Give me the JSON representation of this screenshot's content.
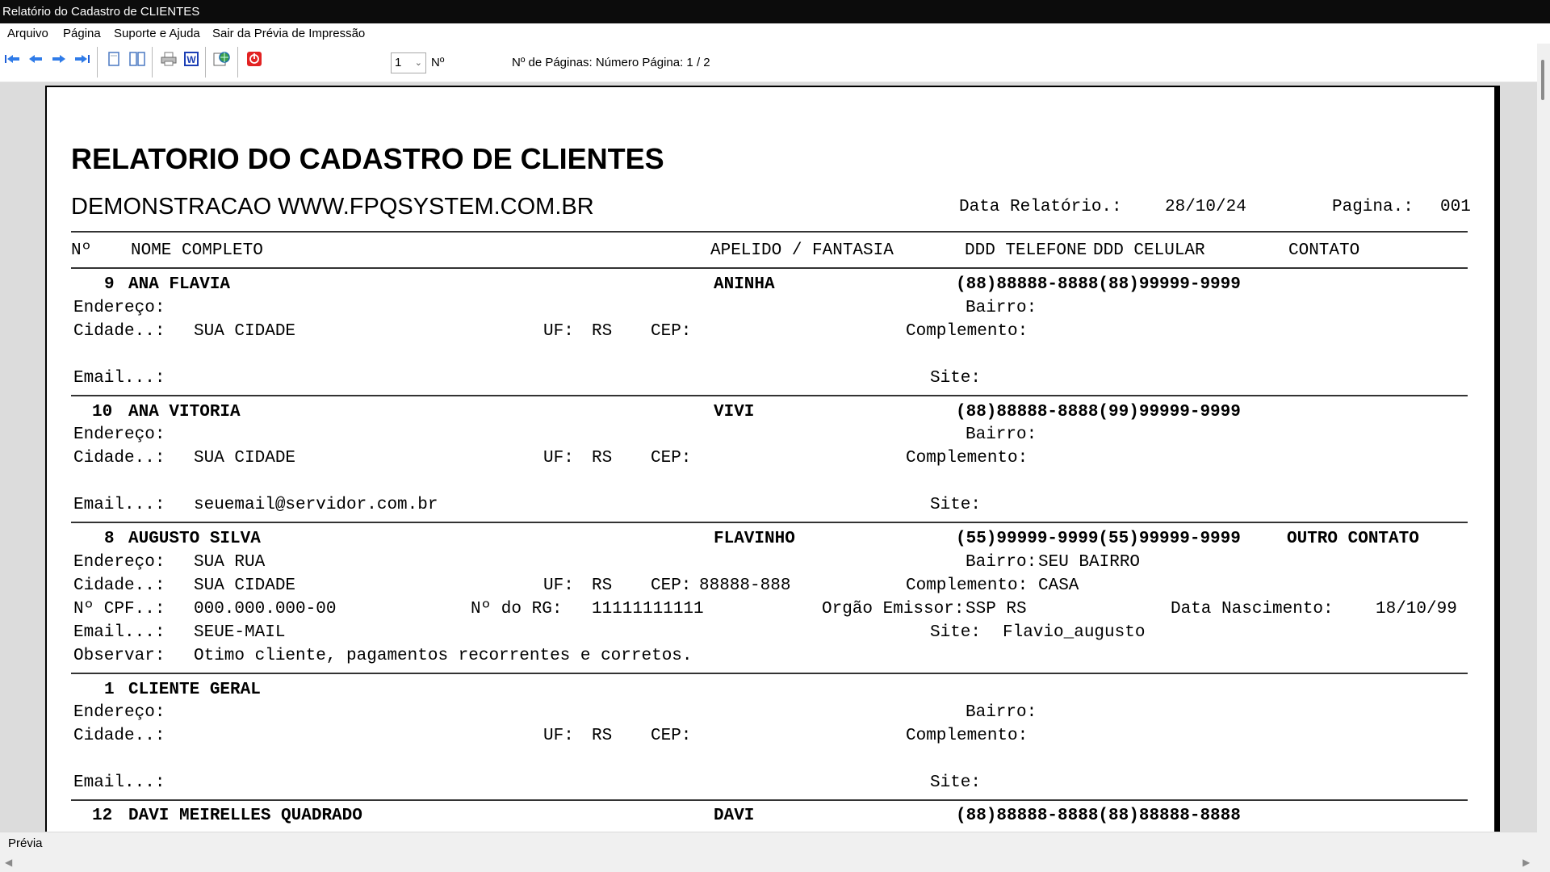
{
  "window": {
    "title": "Relatório do Cadastro de CLIENTES"
  },
  "menu": [
    "Arquivo",
    "Página",
    "Suporte e Ajuda",
    "Sair da Prévia de Impressão"
  ],
  "toolbar": {
    "icons": [
      "first-page-icon",
      "prev-page-icon",
      "next-page-icon",
      "last-page-icon",
      "single-page-icon",
      "two-page-icon",
      "print-icon",
      "word-export-icon",
      "web-export-icon",
      "stop-icon"
    ],
    "page_select_value": "1",
    "no_label": "Nº",
    "pages_info": "Nº de Páginas: Número Página: 1 / 2"
  },
  "report": {
    "title": "RELATORIO DO CADASTRO DE CLIENTES",
    "subtitle": "DEMONSTRACAO WWW.FPQSYSTEM.COM.BR",
    "date_label": "Data Relatório.:",
    "date_value": "28/10/24",
    "page_label": "Pagina.:",
    "page_value": "001",
    "columns": [
      "Nº",
      "NOME COMPLETO",
      "APELIDO / FANTASIA",
      "DDD TELEFONE",
      "DDD CELULAR",
      "CONTATO"
    ],
    "labels": {
      "endereco": "Endereço:",
      "bairro": "Bairro:",
      "cidade": "Cidade..:",
      "uf": "UF:",
      "cep": "CEP:",
      "complemento": "Complemento:",
      "email": "Email...:",
      "site": "Site:",
      "cpf": "Nº CPF..:",
      "rg": "Nº do RG:",
      "orgao": "Orgão Emissor:",
      "nascimento": "Data Nascimento:",
      "observar": "Observar:"
    },
    "records": [
      {
        "num": "9",
        "name": "ANA FLAVIA",
        "nickname": "ANINHA",
        "phones": "(88)88888-8888(88)99999-9999",
        "contact": "",
        "endereco": "",
        "bairro": "",
        "cidade": "SUA CIDADE",
        "uf": "RS",
        "cep": "",
        "complemento": "",
        "email": "",
        "site": ""
      },
      {
        "num": "10",
        "name": "ANA VITORIA",
        "nickname": "VIVI",
        "phones": "(88)88888-8888(99)99999-9999",
        "contact": "",
        "endereco": "",
        "bairro": "",
        "cidade": "SUA CIDADE",
        "uf": "RS",
        "cep": "",
        "complemento": "",
        "email": "seuemail@servidor.com.br",
        "site": ""
      },
      {
        "num": "8",
        "name": "AUGUSTO SILVA",
        "nickname": "FLAVINHO",
        "phones": "(55)99999-9999(55)99999-9999",
        "contact": "OUTRO CONTATO",
        "endereco": "SUA RUA",
        "bairro": "SEU BAIRRO",
        "cidade": "SUA CIDADE",
        "uf": "RS",
        "cep": "88888-888",
        "complemento": "CASA",
        "cpf": "000.000.000-00",
        "rg": "11111111111",
        "orgao": "SSP RS",
        "nascimento": "18/10/99",
        "email": "SEUE-MAIL",
        "site": "Flavio_augusto",
        "observar": "Otimo cliente, pagamentos recorrentes e corretos."
      },
      {
        "num": "1",
        "name": "CLIENTE GERAL",
        "nickname": "",
        "phones": "",
        "contact": "",
        "endereco": "",
        "bairro": "",
        "cidade": "",
        "uf": "RS",
        "cep": "",
        "complemento": "",
        "email": "",
        "site": ""
      },
      {
        "num": "12",
        "name": "DAVI MEIRELLES QUADRADO",
        "nickname": "DAVI",
        "phones": "(88)88888-8888(88)88888-8888",
        "contact": ""
      }
    ]
  },
  "status": {
    "text": "Prévia"
  }
}
